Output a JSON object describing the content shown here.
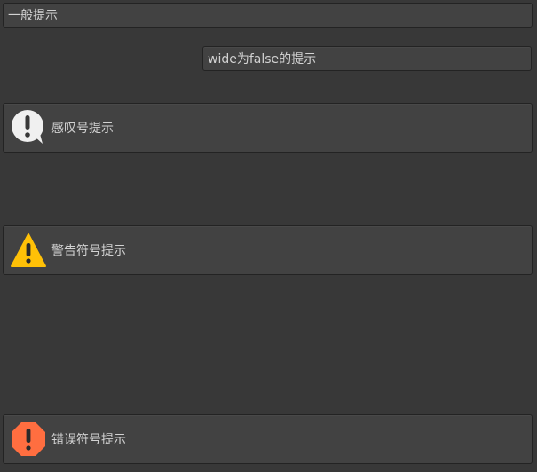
{
  "help_boxes": {
    "general": {
      "text": "一般提示",
      "icon": null
    },
    "wide_false": {
      "text": "wide为false的提示",
      "icon": null
    },
    "info": {
      "text": "感叹号提示",
      "icon": "info-exclamation-bubble-icon",
      "icon_color": "#f0f0f0"
    },
    "warning": {
      "text": "警告符号提示",
      "icon": "warning-triangle-icon",
      "icon_color": "#ffc107"
    },
    "error": {
      "text": "错误符号提示",
      "icon": "error-octagon-icon",
      "icon_color": "#ff6e40"
    }
  },
  "colors": {
    "background": "#383838",
    "box_background": "#424242",
    "box_border": "#232323",
    "text": "#d2d2d2"
  }
}
